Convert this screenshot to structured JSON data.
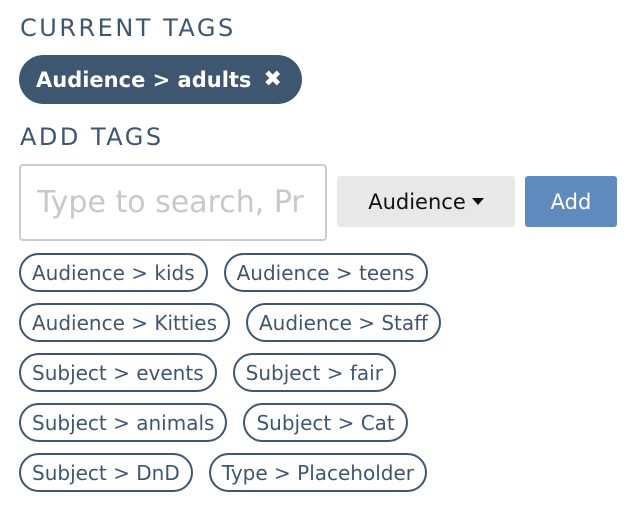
{
  "current": {
    "heading": "CURRENT TAGS",
    "tags": [
      {
        "label": "Audience > adults",
        "remove_icon": "close-icon"
      }
    ]
  },
  "add": {
    "heading": "ADD TAGS",
    "search_placeholder": "Type to search, Pr",
    "category_dropdown": "Audience",
    "add_label": "Add",
    "suggestions": [
      [
        "Audience > kids",
        "Audience > teens"
      ],
      [
        "Audience > Kitties",
        "Audience > Staff"
      ],
      [
        "Subject > events",
        "Subject > fair"
      ],
      [
        "Subject > animals",
        "Subject > Cat"
      ],
      [
        "Subject > DnD",
        "Type > Placeholder"
      ]
    ]
  },
  "colors": {
    "primary": "#3f5670",
    "button": "#5f8abe",
    "dropdown_bg": "#e8e8e8"
  }
}
